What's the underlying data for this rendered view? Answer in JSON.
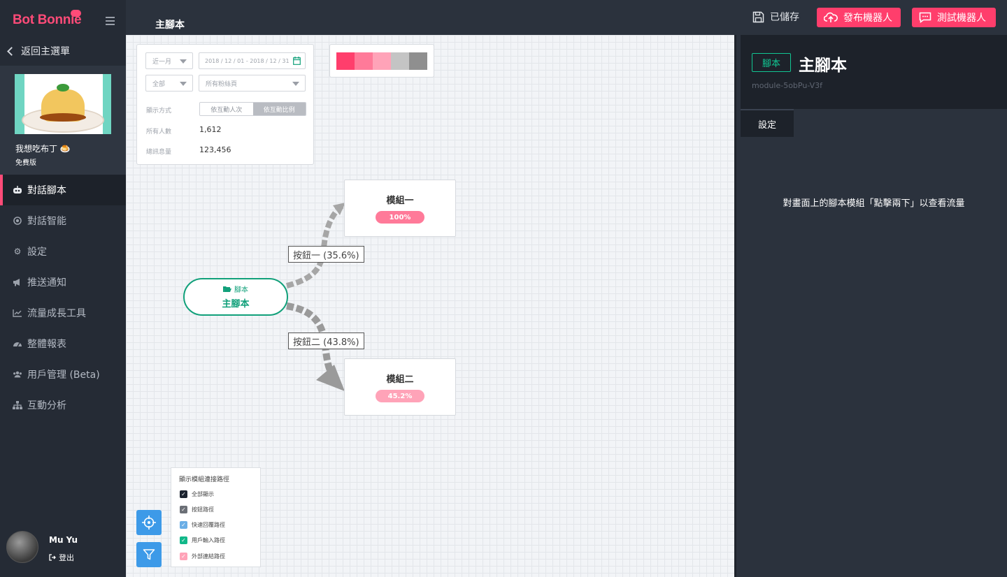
{
  "brand": {
    "name": "Bot Bonnie"
  },
  "sidebar": {
    "back_label": "返回主選單",
    "bot": {
      "name": "我想吃布丁 🍮",
      "plan": "免費版"
    },
    "items": [
      {
        "label": "對話腳本",
        "icon": "robot-icon",
        "active": true
      },
      {
        "label": "對話智能",
        "icon": "target-icon"
      },
      {
        "label": "設定",
        "icon": "gear-icon"
      },
      {
        "label": "推送通知",
        "icon": "megaphone-icon"
      },
      {
        "label": "流量成長工具",
        "icon": "line-chart-icon"
      },
      {
        "label": "整體報表",
        "icon": "gauge-icon"
      },
      {
        "label": "用戶管理 (Beta)",
        "icon": "users-icon"
      },
      {
        "label": "互動分析",
        "icon": "sitemap-icon"
      }
    ],
    "user": {
      "name": "Mu Yu",
      "logout_label": "登出"
    }
  },
  "header": {
    "title": "主腳本",
    "saved_label": "已儲存",
    "publish_label": "發布機器人",
    "test_label": "測試機器人"
  },
  "filter": {
    "period": "近一月",
    "date_range": "2018 / 12 / 01 - 2018 / 12 / 31",
    "scope": "全部",
    "fanpage_placeholder": "所有粉絲頁",
    "display_mode_label": "顯示方式",
    "mode_by_count": "依互動人次",
    "mode_by_ratio": "依互動比例",
    "total_users_label": "所有人數",
    "total_users": "1,612",
    "total_messages_label": "總訊息量",
    "total_messages": "123,456"
  },
  "palette": {
    "colors": [
      "#ff3e6c",
      "#ff7a99",
      "#ffa3b8",
      "#c4c4c4",
      "#8f8f8f"
    ]
  },
  "flow": {
    "script_node": {
      "tag": "腳本",
      "name": "主腳本"
    },
    "modules": [
      {
        "name": "模組一",
        "percent": "100%",
        "color": "#ff7a99"
      },
      {
        "name": "模組二",
        "percent": "45.2%",
        "color": "#ffa3b8"
      }
    ],
    "edges": [
      {
        "label": "按鈕一 (35.6%)"
      },
      {
        "label": "按鈕二 (43.8%)"
      }
    ]
  },
  "path_panel": {
    "title": "顯示模組連接路徑",
    "items": [
      {
        "label": "全部顯示",
        "color": "#1c2430"
      },
      {
        "label": "按鈕路徑",
        "color": "#6b6f76"
      },
      {
        "label": "快速回覆路徑",
        "color": "#6aaee6"
      },
      {
        "label": "用戶輸入路徑",
        "color": "#11b889"
      },
      {
        "label": "外部連結路徑",
        "color": "#ffa3b8"
      }
    ]
  },
  "right_panel": {
    "tag": "腳本",
    "title": "主腳本",
    "module_id": "module-5obPu-V3f",
    "tab": "設定",
    "hint": "對畫面上的腳本模組「點擊兩下」以查看流量"
  }
}
